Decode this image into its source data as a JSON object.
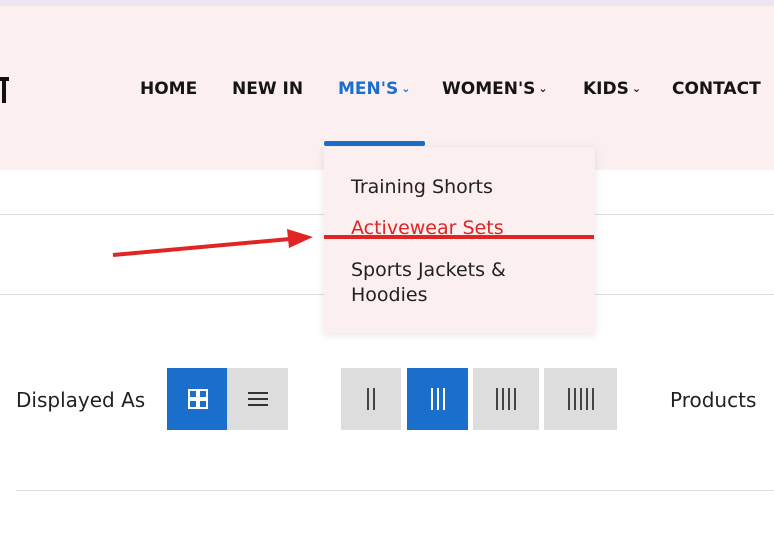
{
  "logo": {
    "fragment": "T"
  },
  "nav": {
    "items": [
      {
        "label": "HOME"
      },
      {
        "label": "NEW IN"
      },
      {
        "label": "MEN'S",
        "active": true
      },
      {
        "label": "WOMEN'S"
      },
      {
        "label": "KIDS"
      },
      {
        "label": "CONTACT"
      }
    ]
  },
  "dropdown": {
    "items": [
      {
        "label": "Training Shorts"
      },
      {
        "label": "Activewear Sets"
      },
      {
        "label": "Sports Jackets &"
      },
      {
        "label": "Hoodies"
      }
    ]
  },
  "toolbar": {
    "displayed_label": "Displayed As",
    "products_label": "Products"
  },
  "colors": {
    "accent": "#1a6fcc",
    "header_bg": "#fbeff0",
    "highlight_red": "#e12424"
  },
  "icons": {
    "grid": "grid-view-icon",
    "list": "list-view-icon",
    "chevron": "chevron-down-icon"
  }
}
